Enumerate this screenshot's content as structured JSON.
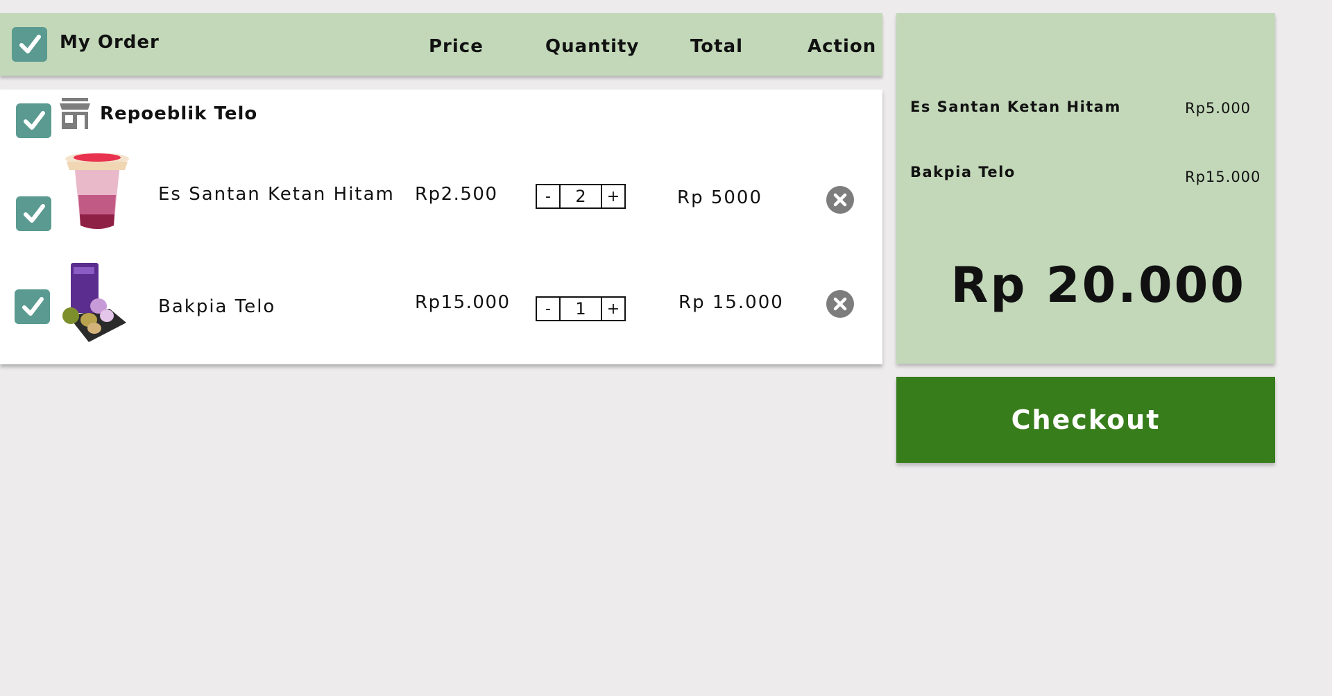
{
  "header": {
    "title": "My Order",
    "columns": {
      "price": "Price",
      "quantity": "Quantity",
      "total": "Total",
      "action": "Action"
    }
  },
  "store": {
    "name": "Repoeblik Telo",
    "icon": "store-icon"
  },
  "items": [
    {
      "name": "Es Santan Ketan Hitam",
      "price": "Rp2.500",
      "quantity": "2",
      "total": "Rp 5000",
      "minus": "-",
      "plus": "+",
      "checked": true
    },
    {
      "name": "Bakpia Telo",
      "price": "Rp15.000",
      "quantity": "1",
      "total": "Rp 15.000",
      "minus": "-",
      "plus": "+",
      "checked": true
    }
  ],
  "summary": {
    "items": [
      {
        "name": "Es Santan Ketan Hitam",
        "price": "Rp5.000"
      },
      {
        "name": "Bakpia Telo",
        "price": "Rp15.000"
      }
    ],
    "total": "Rp 20.000"
  },
  "checkout": {
    "label": "Checkout"
  },
  "colors": {
    "header_bg": "#c2d8b9",
    "checkbox": "#5a9a90",
    "checkout_bg": "#387d1c",
    "remove_icon": "#7d7d7d",
    "page_bg": "#edebec"
  }
}
